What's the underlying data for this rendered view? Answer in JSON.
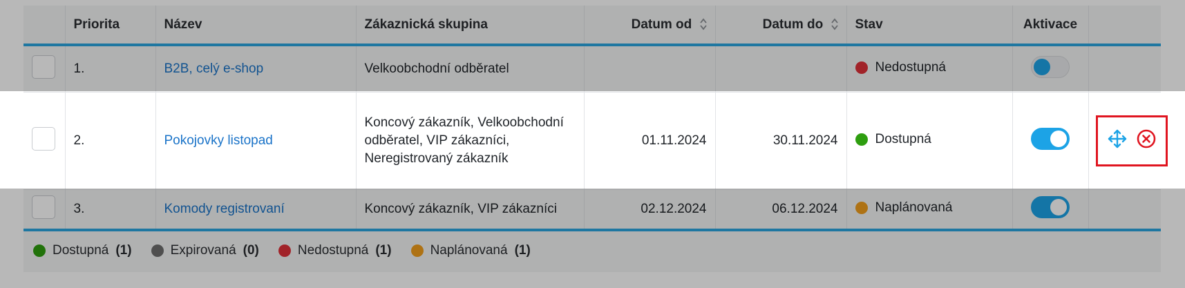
{
  "columns": {
    "priority": "Priorita",
    "name": "Název",
    "group": "Zákaznická skupina",
    "date_from": "Datum od",
    "date_to": "Datum do",
    "state": "Stav",
    "activation": "Aktivace"
  },
  "rows": [
    {
      "priority": "1.",
      "name": "B2B, celý e-shop",
      "group": "Velkoobchodní odběratel",
      "date_from": "",
      "date_to": "",
      "state": "Nedostupná",
      "state_color": "#e0313a",
      "active": false
    },
    {
      "priority": "2.",
      "name": "Pokojovky listopad",
      "group": "Koncový zákazník, Velkoobchodní odběratel, VIP zákazníci, Neregistrovaný zákazník",
      "date_from": "01.11.2024",
      "date_to": "30.11.2024",
      "state": "Dostupná",
      "state_color": "#2e9e0f",
      "active": true
    },
    {
      "priority": "3.",
      "name": "Komody registrovaní",
      "group": "Koncový zákazník, VIP zákazníci",
      "date_from": "02.12.2024",
      "date_to": "06.12.2024",
      "state": "Naplánovaná",
      "state_color": "#f29f1c",
      "active": true
    }
  ],
  "row_actions": {
    "move_icon": "move-arrows-icon",
    "delete_icon": "close-circle-icon"
  },
  "legend": [
    {
      "label": "Dostupná",
      "count": "(1)",
      "color": "#2e9e0f"
    },
    {
      "label": "Expirovaná",
      "count": "(0)",
      "color": "#6e6e6e"
    },
    {
      "label": "Nedostupná",
      "count": "(1)",
      "color": "#e0313a"
    },
    {
      "label": "Naplánovaná",
      "count": "(1)",
      "color": "#f29f1c"
    }
  ],
  "colors": {
    "accent": "#1ca3e6",
    "link": "#1a73c8",
    "highlight_border": "#e01520"
  }
}
